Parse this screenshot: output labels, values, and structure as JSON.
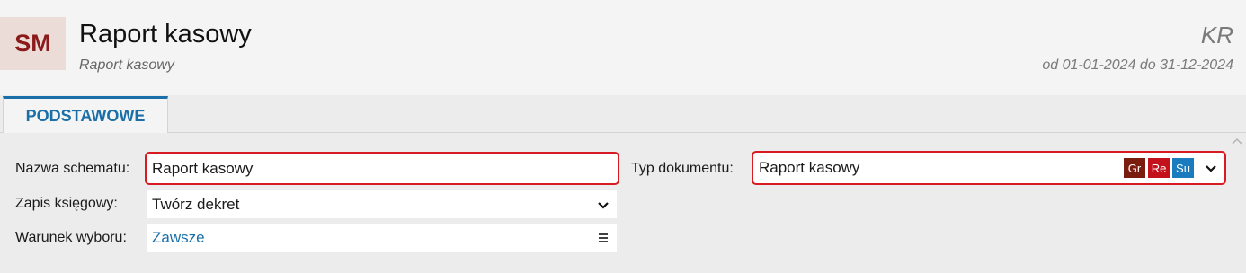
{
  "header": {
    "avatar_text": "SM",
    "title": "Raport kasowy",
    "subtitle": "Raport kasowy",
    "code": "KR",
    "period": "od 01-01-2024 do 31-12-2024"
  },
  "tabs": [
    {
      "label": "PODSTAWOWE",
      "active": true
    }
  ],
  "form": {
    "scheme_name": {
      "label": "Nazwa schematu:",
      "value": "Raport kasowy"
    },
    "accounting_entry": {
      "label": "Zapis księgowy:",
      "value": "Twórz dekret"
    },
    "selection_condition": {
      "label": "Warunek wyboru:",
      "value": "Zawsze"
    },
    "document_type": {
      "label": "Typ dokumentu:",
      "value": "Raport kasowy",
      "badges": [
        {
          "text": "Gr",
          "color": "#7a1c0e"
        },
        {
          "text": "Re",
          "color": "#c4121c"
        },
        {
          "text": "Su",
          "color": "#1a7bbf"
        }
      ]
    }
  },
  "colors": {
    "accent": "#1a6fa8",
    "highlight_border": "#d81b23",
    "avatar_text": "#8b1a1a",
    "avatar_bg": "#ecdcd8"
  }
}
